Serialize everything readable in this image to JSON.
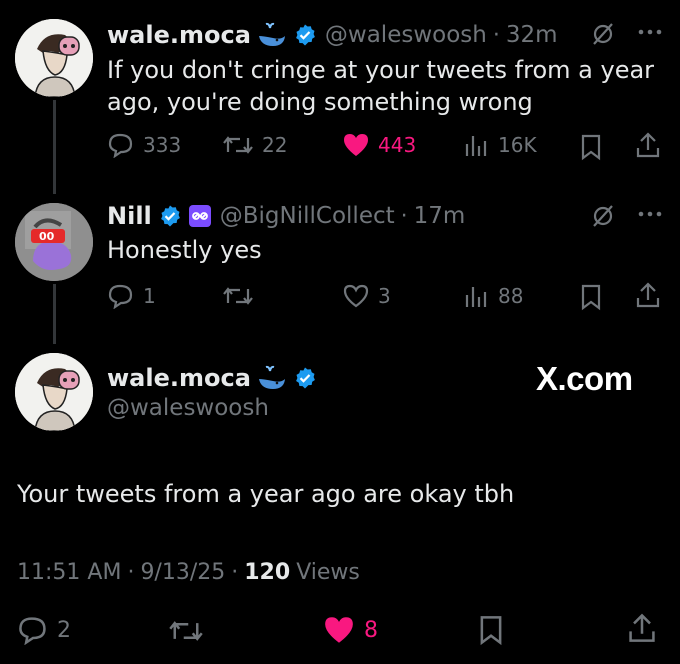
{
  "tweet1": {
    "name": "wale.moca",
    "handle": "@waleswoosh",
    "sep": "·",
    "time": "32m",
    "text_line1": "If you don't cringe at your tweets from a year",
    "text_line2": "ago, you're doing something wrong",
    "replies": "333",
    "retweets": "22",
    "likes": "443",
    "views": "16K",
    "liked": true
  },
  "tweet2": {
    "name": "Nill",
    "handle": "@BigNillCollect",
    "sep": "·",
    "time": "17m",
    "text": "Honestly yes",
    "replies": "1",
    "retweets": "",
    "likes": "3",
    "views": "88",
    "liked": false
  },
  "tweet3": {
    "name": "wale.moca",
    "handle": "@waleswoosh",
    "text": "Your tweets from a year ago are okay tbh",
    "time": "11:51 AM",
    "date": "9/13/25",
    "views_count": "120",
    "views_label": "Views",
    "replies": "2",
    "likes": "8",
    "liked": true
  },
  "watermark": "X.com",
  "colors": {
    "background": "#000000",
    "text": "#e7e9ea",
    "muted": "#71767b",
    "like": "#f91880",
    "verified": "#1d9bf0",
    "affiliate": "#7b4cff"
  }
}
